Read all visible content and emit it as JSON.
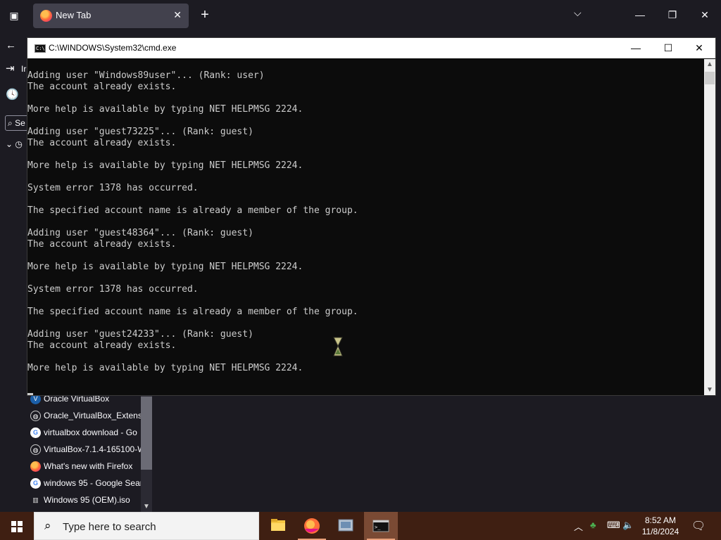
{
  "firefox": {
    "tab_title": "New Tab",
    "sidebar_partial_text": "Ir",
    "sidebar_search_partial": "Se"
  },
  "library_items": [
    {
      "label": "Oracle VirtualBox",
      "icon": "virtualbox-icon"
    },
    {
      "label": "Oracle_VirtualBox_Extensi",
      "icon": "globe-icon"
    },
    {
      "label": "virtualbox download - Go",
      "icon": "google-icon"
    },
    {
      "label": "VirtualBox-7.1.4-165100-W",
      "icon": "globe-icon"
    },
    {
      "label": "What's new with Firefox",
      "icon": "firefox-icon"
    },
    {
      "label": "windows 95 - Google Sear",
      "icon": "google-icon"
    },
    {
      "label": "Windows 95 (OEM).iso",
      "icon": "archive-icon"
    }
  ],
  "cmd": {
    "title": "C:\\WINDOWS\\System32\\cmd.exe",
    "lines": [
      "Adding user \"Windows89user\"... (Rank: user)",
      "The account already exists.",
      "",
      "More help is available by typing NET HELPMSG 2224.",
      "",
      "Adding user \"guest73225\"... (Rank: guest)",
      "The account already exists.",
      "",
      "More help is available by typing NET HELPMSG 2224.",
      "",
      "System error 1378 has occurred.",
      "",
      "The specified account name is already a member of the group.",
      "",
      "Adding user \"guest48364\"... (Rank: guest)",
      "The account already exists.",
      "",
      "More help is available by typing NET HELPMSG 2224.",
      "",
      "System error 1378 has occurred.",
      "",
      "The specified account name is already a member of the group.",
      "",
      "Adding user \"guest24233\"... (Rank: guest)",
      "The account already exists.",
      "",
      "More help is available by typing NET HELPMSG 2224."
    ]
  },
  "taskbar": {
    "search_placeholder": "Type here to search",
    "time": "8:52 AM",
    "date": "11/8/2024"
  },
  "colors": {
    "taskbar": "#3f1f12",
    "firefox_bg": "#1c1b22",
    "console_bg": "#0c0c0c",
    "console_text": "#cccccc"
  }
}
